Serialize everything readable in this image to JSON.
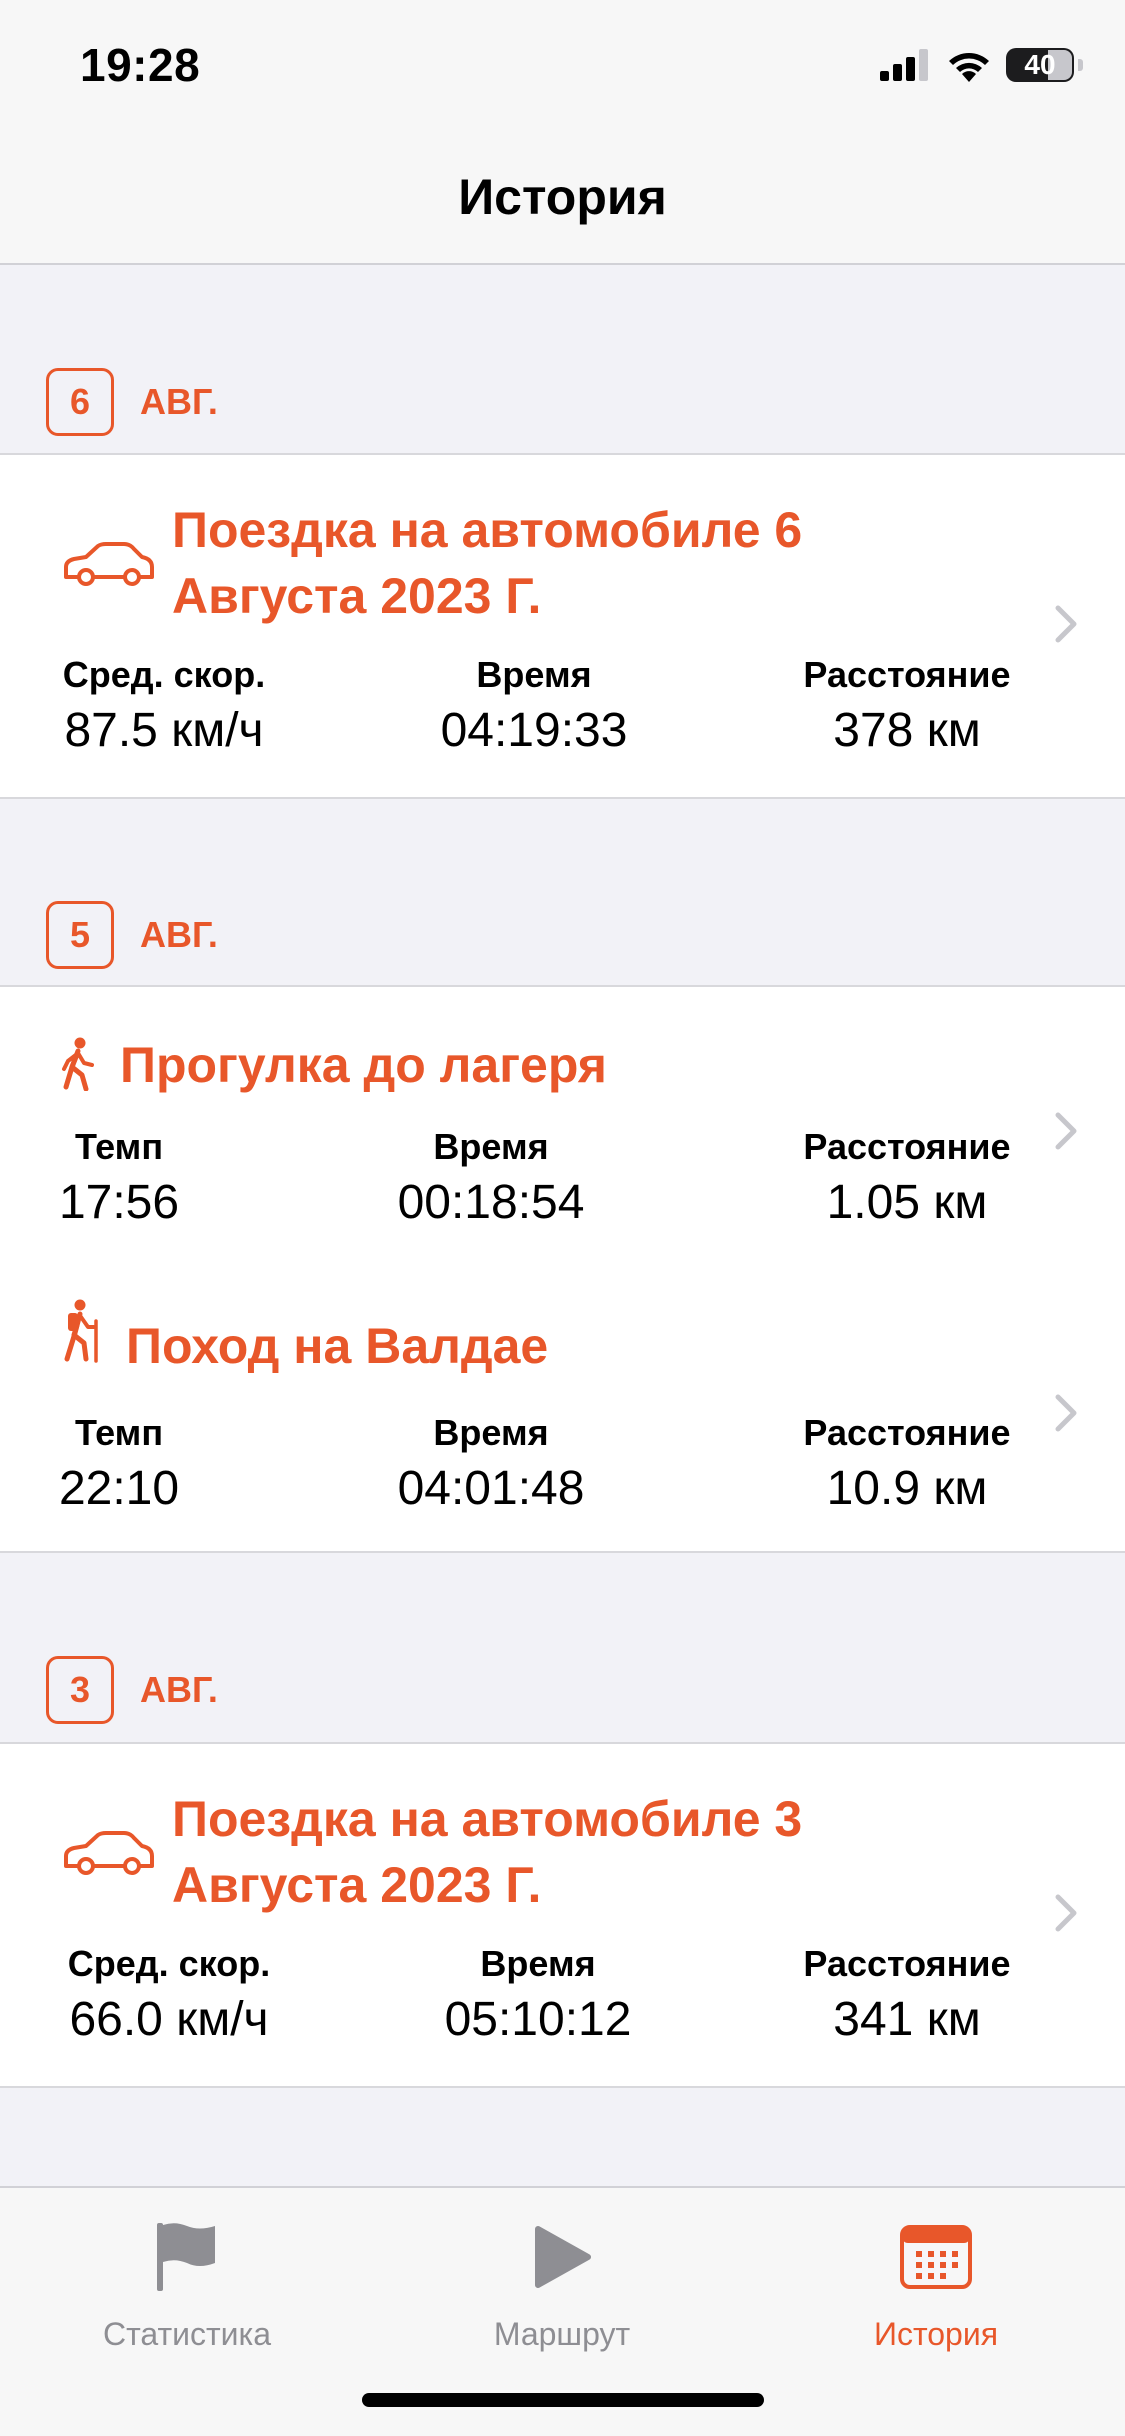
{
  "status_bar": {
    "time": "19:28",
    "battery": "40"
  },
  "nav": {
    "title": "История"
  },
  "sections": [
    {
      "day": "6",
      "month": "АВГ.",
      "trips": [
        {
          "icon": "car-icon",
          "title_line1": "Поездка на автомобиле 6",
          "title_line2": "Августа 2023 Г.",
          "stats": [
            {
              "label": "Сред. скор.",
              "value": "87.5 км/ч"
            },
            {
              "label": "Время",
              "value": "04:19:33"
            },
            {
              "label": "Расстояние",
              "value": "378 км"
            }
          ]
        }
      ]
    },
    {
      "day": "5",
      "month": "АВГ.",
      "trips": [
        {
          "icon": "walking-icon",
          "title_line1": "Прогулка до лагеря",
          "stats": [
            {
              "label": "Темп",
              "value": "17:56"
            },
            {
              "label": "Время",
              "value": "00:18:54"
            },
            {
              "label": "Расстояние",
              "value": "1.05 км"
            }
          ]
        },
        {
          "icon": "hiking-icon",
          "title_line1": "Поход на Валдае",
          "stats": [
            {
              "label": "Темп",
              "value": "22:10"
            },
            {
              "label": "Время",
              "value": "04:01:48"
            },
            {
              "label": "Расстояние",
              "value": "10.9 км"
            }
          ]
        }
      ]
    },
    {
      "day": "3",
      "month": "АВГ.",
      "trips": [
        {
          "icon": "car-icon",
          "title_line1": "Поездка на автомобиле 3",
          "title_line2": "Августа 2023 Г.",
          "stats": [
            {
              "label": "Сред. скор.",
              "value": "66.0 км/ч"
            },
            {
              "label": "Время",
              "value": "05:10:12"
            },
            {
              "label": "Расстояние",
              "value": "341 км"
            }
          ]
        }
      ]
    }
  ],
  "tab_bar": {
    "tabs": [
      {
        "label": "Статистика",
        "icon": "flag-icon",
        "active": false
      },
      {
        "label": "Маршрут",
        "icon": "play-icon",
        "active": false
      },
      {
        "label": "История",
        "icon": "calendar-icon",
        "active": true
      }
    ]
  },
  "colors": {
    "accent": "#e8572a",
    "inactive": "#8e8e93",
    "background": "#f2f2f7"
  }
}
